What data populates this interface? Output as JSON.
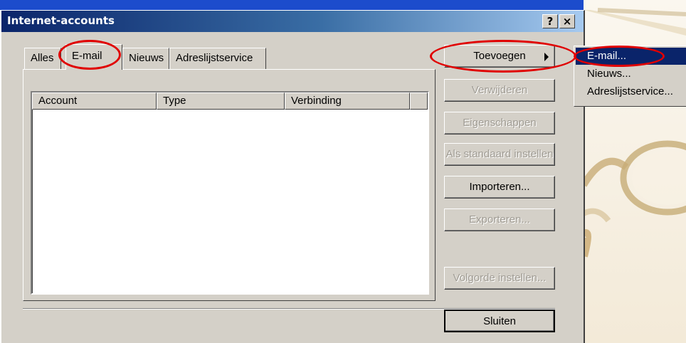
{
  "window": {
    "title": "Internet-accounts",
    "help_button": "?",
    "close_button": "×"
  },
  "tabs": [
    {
      "label": "Alles",
      "active": false
    },
    {
      "label": "E-mail",
      "active": true
    },
    {
      "label": "Nieuws",
      "active": false
    },
    {
      "label": "Adreslijstservice",
      "active": false
    }
  ],
  "list": {
    "columns": [
      "Account",
      "Type",
      "Verbinding"
    ],
    "rows": []
  },
  "buttons": {
    "add": "Toevoegen",
    "remove": "Verwijderen",
    "properties": "Eigenschappen",
    "set_default": "Als standaard instellen",
    "import": "Importeren...",
    "export": "Exporteren...",
    "set_order": "Volgorde instellen...",
    "close": "Sluiten"
  },
  "add_menu": {
    "items": [
      "E-mail...",
      "Nieuws...",
      "Adreslijstservice..."
    ],
    "selected": "E-mail..."
  },
  "colors": {
    "highlight_ring": "#e00000",
    "selection": "#0a246a",
    "titlebar": "#0a246a"
  },
  "icons": {
    "submenu": "chevron-right-icon",
    "help": "help-icon",
    "close": "close-icon"
  }
}
